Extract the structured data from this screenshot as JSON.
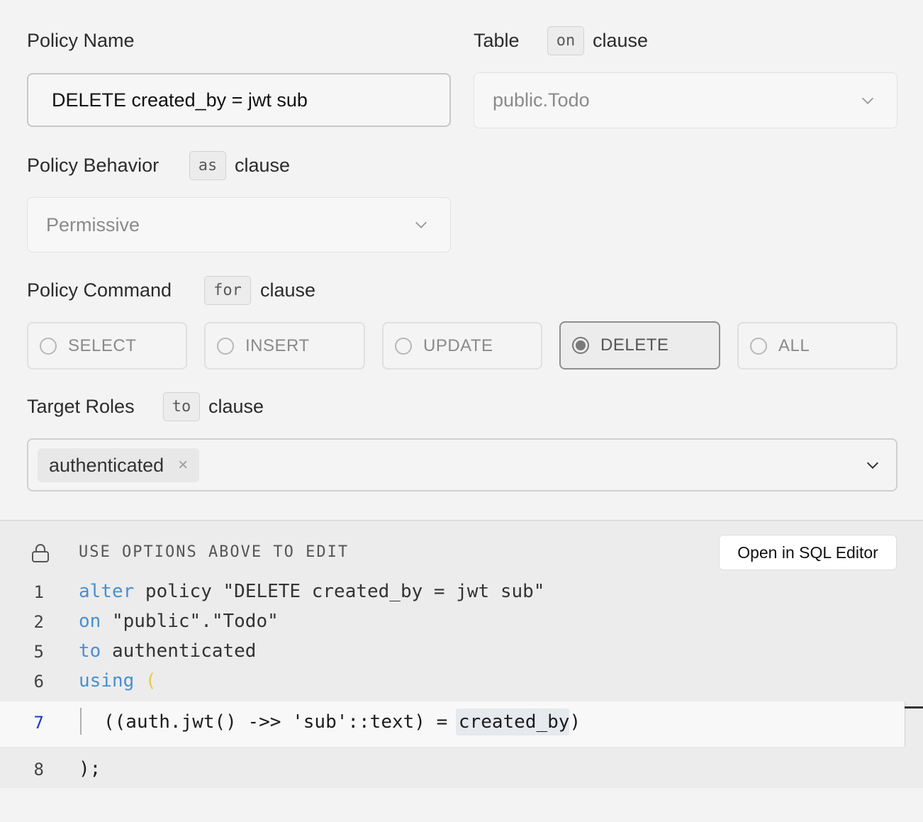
{
  "policy_name": {
    "label": "Policy Name",
    "value": "DELETE created_by = jwt sub"
  },
  "table": {
    "label": "Table",
    "chip": "on",
    "clause": "clause",
    "value": "public.Todo"
  },
  "behavior": {
    "label": "Policy Behavior",
    "chip": "as",
    "clause": "clause",
    "value": "Permissive"
  },
  "command": {
    "label": "Policy Command",
    "chip": "for",
    "clause": "clause",
    "options": [
      "SELECT",
      "INSERT",
      "UPDATE",
      "DELETE",
      "ALL"
    ],
    "selected": "DELETE"
  },
  "roles": {
    "label": "Target Roles",
    "chip": "to",
    "clause": "clause",
    "tags": [
      "authenticated"
    ],
    "remove_glyph": "×"
  },
  "editor": {
    "hint": "USE OPTIONS ABOVE TO EDIT",
    "open_button": "Open in SQL Editor",
    "line_numbers": [
      "1",
      "2",
      "5",
      "6",
      "7",
      "8"
    ],
    "lines": [
      {
        "kw": "alter",
        "rest": " policy \"DELETE created_by = jwt sub\""
      },
      {
        "kw": "on",
        "rest": " \"public\".\"Todo\""
      },
      {
        "kw": "to",
        "rest": " authenticated"
      },
      {
        "kw": "using",
        "rest": " ("
      },
      {
        "text": "((auth.jwt() ->> 'sub'::text) = created_by)"
      },
      {
        "text": ");"
      }
    ]
  },
  "colors": {
    "keyword": "#4a8fd0",
    "string_literal": "#4a9a5e",
    "paren_yellow": "#e8c94a",
    "active_line_number": "#1a37c8"
  }
}
